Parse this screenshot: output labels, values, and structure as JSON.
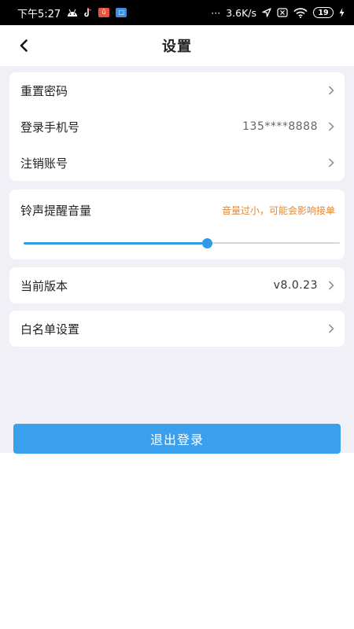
{
  "status_bar": {
    "time": "下午5:27",
    "app_icons": [
      "android-icon",
      "tiktok-icon",
      "orange-app-icon",
      "blue-app-icon"
    ],
    "more": "···",
    "network_speed": "3.6K/s",
    "battery": "19"
  },
  "nav": {
    "title": "设置"
  },
  "account": {
    "items": [
      {
        "label": "重置密码",
        "value": ""
      },
      {
        "label": "登录手机号",
        "value": "135****8888"
      },
      {
        "label": "注销账号",
        "value": ""
      }
    ]
  },
  "volume": {
    "label": "铃声提醒音量",
    "hint": "音量过小，可能会影响接单",
    "level": 0.58
  },
  "version": {
    "label": "当前版本",
    "value": "v8.0.23"
  },
  "whitelist": {
    "label": "白名单设置"
  },
  "logout": {
    "label": "退出登录"
  },
  "colors": {
    "accent": "#3aa0ee",
    "hint": "#e08a3c",
    "page_bg": "#f0f0f6"
  }
}
